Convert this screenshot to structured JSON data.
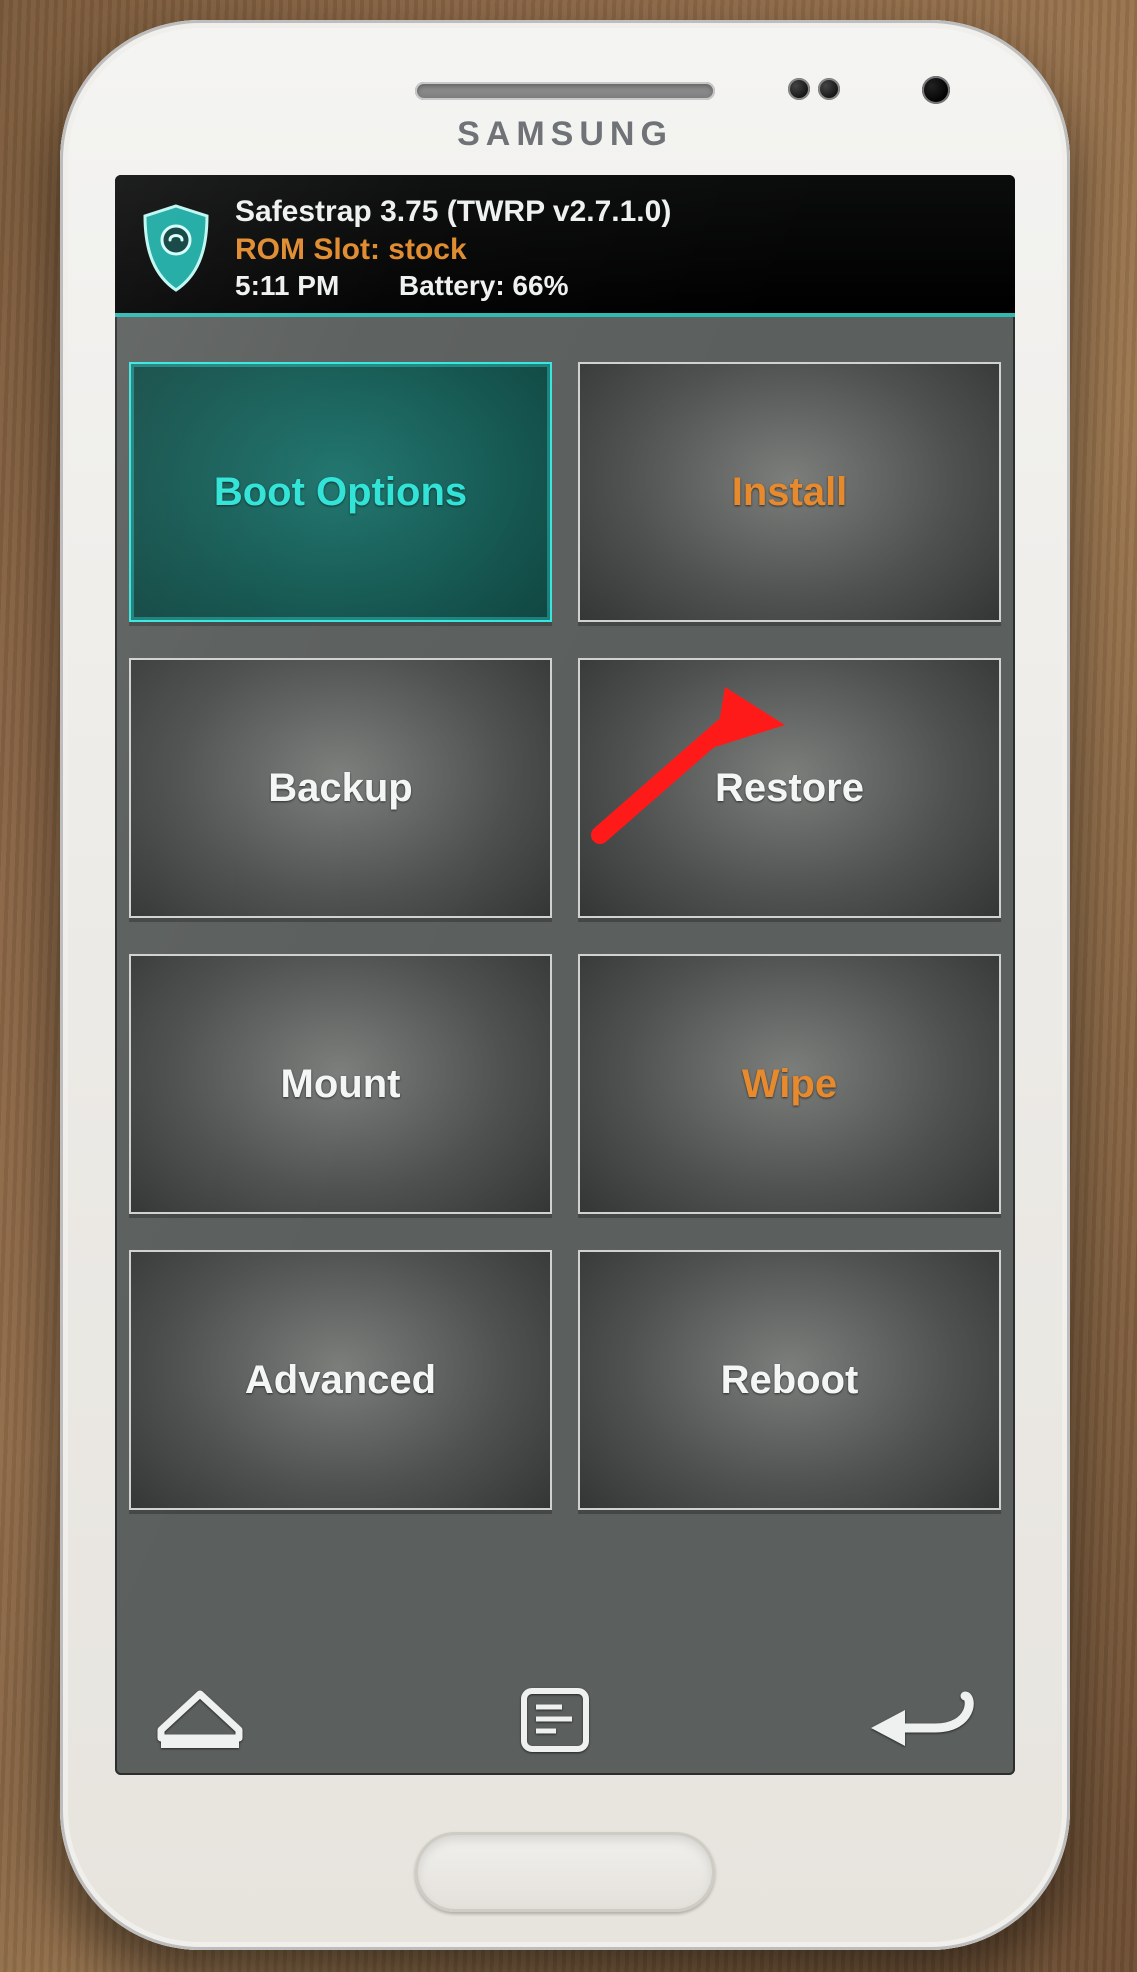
{
  "device_brand": "SAMSUNG",
  "header": {
    "title": "Safestrap 3.75 (TWRP v2.7.1.0)",
    "rom_slot_label": "ROM Slot: stock",
    "time": "5:11 PM",
    "battery": "Battery: 66%"
  },
  "tiles": [
    {
      "id": "boot-options",
      "label": "Boot Options",
      "style": "highlight"
    },
    {
      "id": "install",
      "label": "Install",
      "style": "orange"
    },
    {
      "id": "backup",
      "label": "Backup",
      "style": "normal"
    },
    {
      "id": "restore",
      "label": "Restore",
      "style": "normal"
    },
    {
      "id": "mount",
      "label": "Mount",
      "style": "normal"
    },
    {
      "id": "wipe",
      "label": "Wipe",
      "style": "orange"
    },
    {
      "id": "advanced",
      "label": "Advanced",
      "style": "normal"
    },
    {
      "id": "reboot",
      "label": "Reboot",
      "style": "normal"
    }
  ],
  "nav": {
    "home_icon": "home-icon",
    "log_icon": "terminal-log-icon",
    "back_icon": "back-icon"
  },
  "annotation": {
    "arrow_points_to_tile": "install",
    "color": "#ff1a1a"
  },
  "colors": {
    "accent_teal": "#2fe3d7",
    "accent_orange": "#e68a2d",
    "header_divider": "#2fb9b1"
  }
}
